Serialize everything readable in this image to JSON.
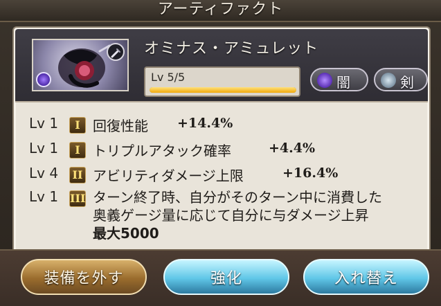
{
  "window": {
    "title": "アーティファクト"
  },
  "artifact": {
    "name": "オミナス・アミュレット",
    "level_text": "Lv 5/5",
    "level_progress": 1.0,
    "element_label": "闇",
    "weapon_label": "剣",
    "icons": {
      "thumbnail": "artifact-amulet-image",
      "thumb_weapon_badge": "sword-icon",
      "thumb_element_badge": "dark-element-icon"
    }
  },
  "skills": [
    {
      "level": "Lv 1",
      "tier": "I",
      "name": "回復性能",
      "value": "+14.4%"
    },
    {
      "level": "Lv 1",
      "tier": "I",
      "name": "トリプルアタック確率",
      "value": "+4.4%"
    },
    {
      "level": "Lv 4",
      "tier": "II",
      "name": "アビリティダメージ上限",
      "value": "+16.4%"
    },
    {
      "level": "Lv 1",
      "tier": "III",
      "line1": "ターン終了時、自分がそのターン中に消費した",
      "line2": "奥義ゲージ量に応じて自分に与ダメージ上昇",
      "line3": "最大5000"
    }
  ],
  "buttons": {
    "unequip": "装備を外す",
    "upgrade": "強化",
    "swap": "入れ替え"
  },
  "colors": {
    "panel_bg": "#e9e4da",
    "header_bg": "#3f3d45",
    "gold_bar": "#f1a90b",
    "blue_button": "#5fc6e7",
    "brown_button": "#9a6c2d"
  }
}
